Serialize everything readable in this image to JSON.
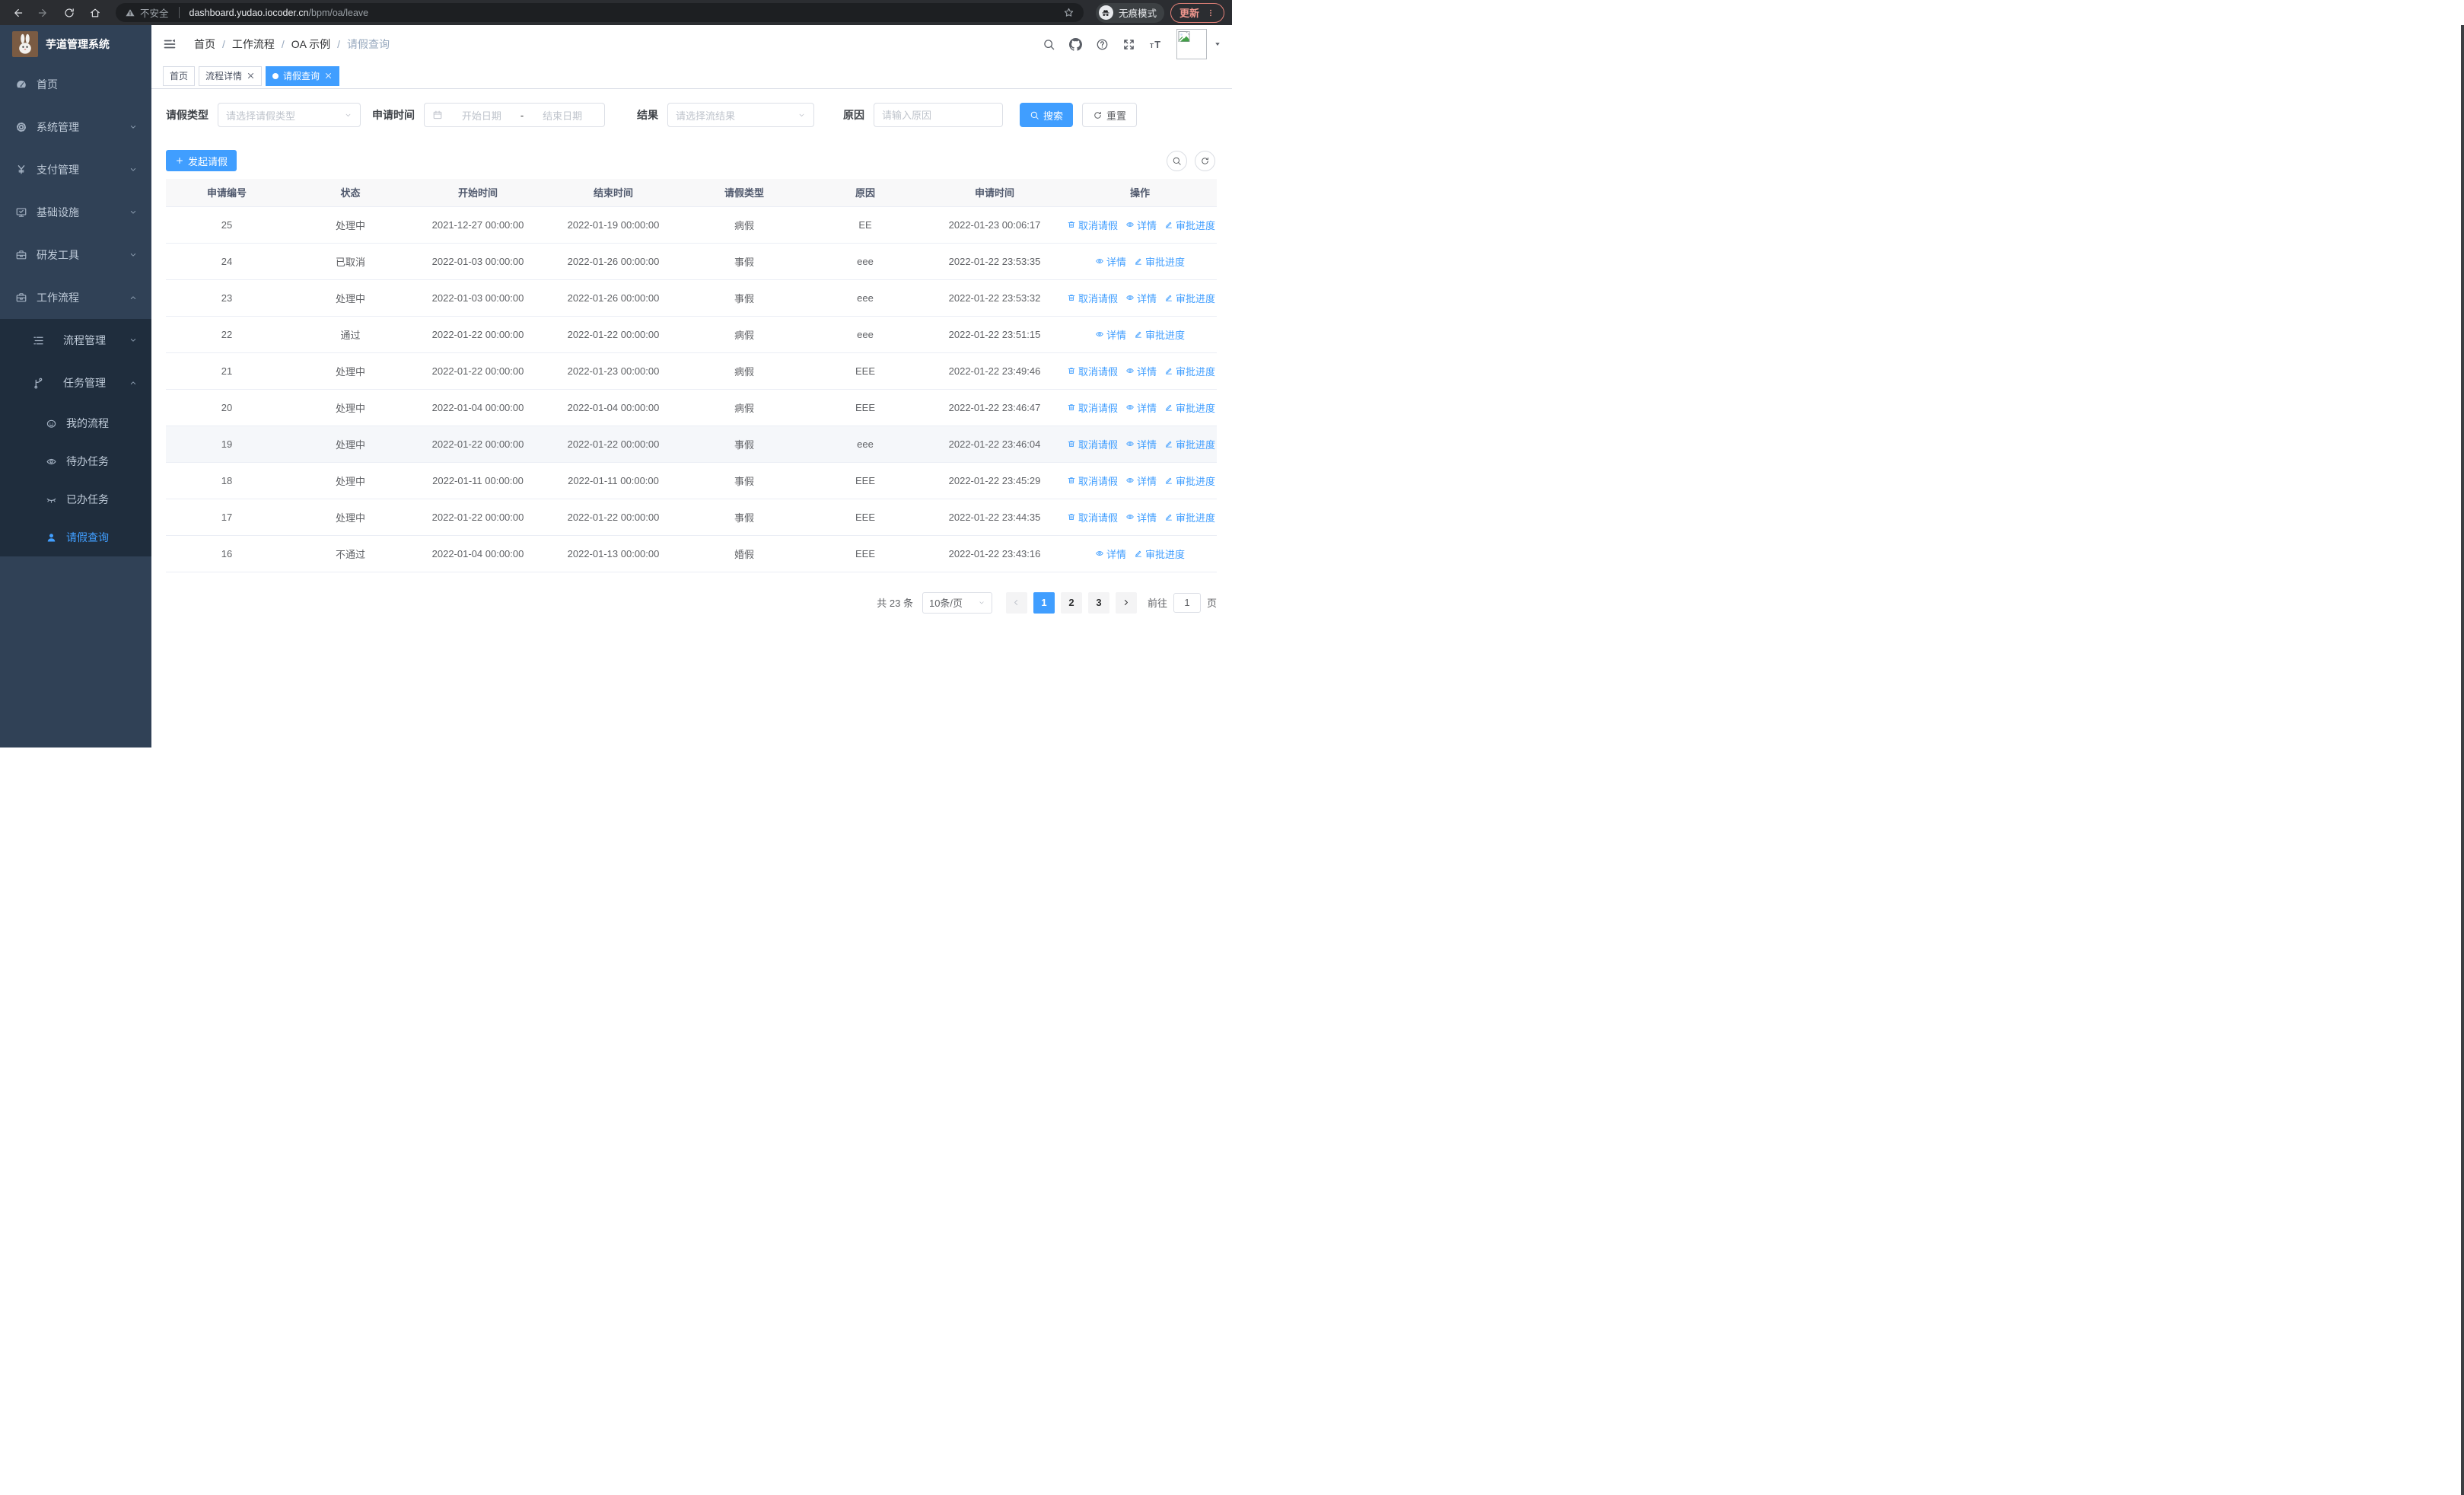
{
  "browser": {
    "security_label": "不安全",
    "url_host": "dashboard.yudao.iocoder.cn",
    "url_path": "/bpm/oa/leave",
    "incognito_label": "无痕模式",
    "update_label": "更新"
  },
  "colors": {
    "accent": "#409eff",
    "sidebar_bg": "#304156",
    "submenu_bg": "#1f2d3d",
    "table_header_bg": "#f8f8f9",
    "update_accent": "#f0978e"
  },
  "sidebar": {
    "title": "芋道管理系统",
    "items": [
      {
        "label": "首页",
        "icon": "dashboard-icon",
        "level": 1
      },
      {
        "label": "系统管理",
        "icon": "gear-icon",
        "level": 1,
        "chevron": "down"
      },
      {
        "label": "支付管理",
        "icon": "yen-icon",
        "level": 1,
        "chevron": "down"
      },
      {
        "label": "基础设施",
        "icon": "monitor-icon",
        "level": 1,
        "chevron": "down"
      },
      {
        "label": "研发工具",
        "icon": "toolbox-icon",
        "level": 1,
        "chevron": "down"
      },
      {
        "label": "工作流程",
        "icon": "briefcase-icon",
        "level": 1,
        "chevron": "up"
      },
      {
        "label": "流程管理",
        "icon": "list-icon",
        "level": 2,
        "sub": true,
        "chevron": "down"
      },
      {
        "label": "任务管理",
        "icon": "flow-icon",
        "level": 2,
        "sub": true,
        "chevron": "up"
      },
      {
        "label": "我的流程",
        "icon": "face-icon",
        "level": 3,
        "sub": true
      },
      {
        "label": "待办任务",
        "icon": "eye-open-icon",
        "level": 3,
        "sub": true
      },
      {
        "label": "已办任务",
        "icon": "eye-closed-icon",
        "level": 3,
        "sub": true
      },
      {
        "label": "请假查询",
        "icon": "user-icon",
        "level": 3,
        "sub": true,
        "active": true
      }
    ]
  },
  "header": {
    "breadcrumb": [
      "首页",
      "工作流程",
      "OA 示例",
      "请假查询"
    ],
    "action_icons": [
      "search-icon",
      "github-icon",
      "question-icon",
      "fullscreen-icon",
      "font-size-icon"
    ],
    "tabs": [
      {
        "label": "首页"
      },
      {
        "label": "流程详情",
        "closable": true
      },
      {
        "label": "请假查询",
        "closable": true,
        "active": true
      }
    ]
  },
  "filters": {
    "leave_type_label": "请假类型",
    "leave_type_placeholder": "请选择请假类型",
    "apply_time_label": "申请时间",
    "start_date_placeholder": "开始日期",
    "date_separator": "-",
    "end_date_placeholder": "结束日期",
    "result_label": "结果",
    "result_placeholder": "请选择流结果",
    "reason_label": "原因",
    "reason_placeholder": "请输入原因",
    "search_label": "搜索",
    "reset_label": "重置"
  },
  "toolbar": {
    "create_label": "发起请假"
  },
  "table": {
    "columns": [
      "申请编号",
      "状态",
      "开始时间",
      "结束时间",
      "请假类型",
      "原因",
      "申请时间",
      "操作"
    ],
    "actions": {
      "cancel": "取消请假",
      "detail": "详情",
      "progress": "审批进度"
    },
    "rows": [
      {
        "id": "25",
        "status": "处理中",
        "start": "2021-12-27 00:00:00",
        "end": "2022-01-19 00:00:00",
        "type": "病假",
        "reason": "EE",
        "applied": "2022-01-23 00:06:17",
        "can_cancel": true,
        "highlight": false
      },
      {
        "id": "24",
        "status": "已取消",
        "start": "2022-01-03 00:00:00",
        "end": "2022-01-26 00:00:00",
        "type": "事假",
        "reason": "eee",
        "applied": "2022-01-22 23:53:35",
        "can_cancel": false,
        "highlight": false
      },
      {
        "id": "23",
        "status": "处理中",
        "start": "2022-01-03 00:00:00",
        "end": "2022-01-26 00:00:00",
        "type": "事假",
        "reason": "eee",
        "applied": "2022-01-22 23:53:32",
        "can_cancel": true,
        "highlight": false
      },
      {
        "id": "22",
        "status": "通过",
        "start": "2022-01-22 00:00:00",
        "end": "2022-01-22 00:00:00",
        "type": "病假",
        "reason": "eee",
        "applied": "2022-01-22 23:51:15",
        "can_cancel": false,
        "highlight": false
      },
      {
        "id": "21",
        "status": "处理中",
        "start": "2022-01-22 00:00:00",
        "end": "2022-01-23 00:00:00",
        "type": "病假",
        "reason": "EEE",
        "applied": "2022-01-22 23:49:46",
        "can_cancel": true,
        "highlight": false
      },
      {
        "id": "20",
        "status": "处理中",
        "start": "2022-01-04 00:00:00",
        "end": "2022-01-04 00:00:00",
        "type": "病假",
        "reason": "EEE",
        "applied": "2022-01-22 23:46:47",
        "can_cancel": true,
        "highlight": false
      },
      {
        "id": "19",
        "status": "处理中",
        "start": "2022-01-22 00:00:00",
        "end": "2022-01-22 00:00:00",
        "type": "事假",
        "reason": "eee",
        "applied": "2022-01-22 23:46:04",
        "can_cancel": true,
        "highlight": true
      },
      {
        "id": "18",
        "status": "处理中",
        "start": "2022-01-11 00:00:00",
        "end": "2022-01-11 00:00:00",
        "type": "事假",
        "reason": "EEE",
        "applied": "2022-01-22 23:45:29",
        "can_cancel": true,
        "highlight": false
      },
      {
        "id": "17",
        "status": "处理中",
        "start": "2022-01-22 00:00:00",
        "end": "2022-01-22 00:00:00",
        "type": "事假",
        "reason": "EEE",
        "applied": "2022-01-22 23:44:35",
        "can_cancel": true,
        "highlight": false
      },
      {
        "id": "16",
        "status": "不通过",
        "start": "2022-01-04 00:00:00",
        "end": "2022-01-13 00:00:00",
        "type": "婚假",
        "reason": "EEE",
        "applied": "2022-01-22 23:43:16",
        "can_cancel": false,
        "highlight": false
      }
    ]
  },
  "pagination": {
    "total": "共 23 条",
    "page_size": "10条/页",
    "pages": [
      "1",
      "2",
      "3"
    ],
    "active_page": "1",
    "goto_label": "前往",
    "goto_value": "1",
    "page_unit": "页"
  }
}
